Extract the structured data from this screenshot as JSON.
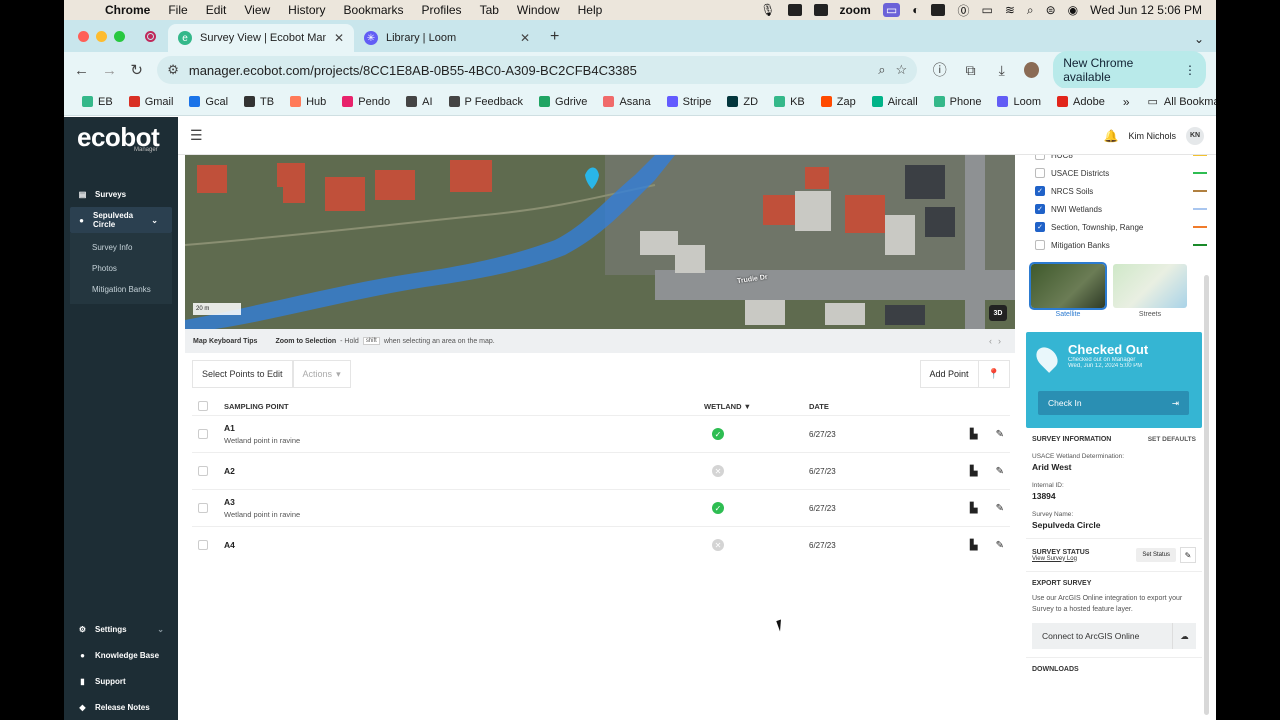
{
  "menubar": {
    "app": "Chrome",
    "items": [
      "File",
      "Edit",
      "View",
      "History",
      "Bookmarks",
      "Profiles",
      "Tab",
      "Window",
      "Help"
    ],
    "zoom": "zoom",
    "datetime": "Wed Jun 12  5:06 PM"
  },
  "tabs": [
    {
      "title": "Survey View | Ecobot Manage",
      "active": true,
      "color": "#34b88a"
    },
    {
      "title": "Library | Loom",
      "active": false,
      "color": "#625df5"
    }
  ],
  "toolbar": {
    "url": "manager.ecobot.com/projects/8CC1E8AB-0B55-4BC0-A309-BC2CFB4C3385",
    "new_chrome": "New Chrome available"
  },
  "bookmarks": [
    {
      "label": "EB",
      "color": "#34b88a"
    },
    {
      "label": "Gmail",
      "color": "#d93025"
    },
    {
      "label": "Gcal",
      "color": "#1a73e8"
    },
    {
      "label": "TB",
      "color": "#333333"
    },
    {
      "label": "Hub",
      "color": "#ff7a59"
    },
    {
      "label": "Pendo",
      "color": "#e8226b"
    },
    {
      "label": "AI",
      "color": "#444444"
    },
    {
      "label": "P Feedback",
      "color": "#444444"
    },
    {
      "label": "Gdrive",
      "color": "#1fa463"
    },
    {
      "label": "Asana",
      "color": "#f06a6a"
    },
    {
      "label": "Stripe",
      "color": "#635bff"
    },
    {
      "label": "ZD",
      "color": "#03363d"
    },
    {
      "label": "KB",
      "color": "#34b88a"
    },
    {
      "label": "Zap",
      "color": "#ff4a00"
    },
    {
      "label": "Aircall",
      "color": "#00b388"
    },
    {
      "label": "Phone",
      "color": "#34b88a"
    },
    {
      "label": "Loom",
      "color": "#625df5"
    },
    {
      "label": "Adobe",
      "color": "#e1251b"
    }
  ],
  "bookmarks_more": "»",
  "bookmarks_all": "All Bookmarks",
  "sidebar": {
    "logo": "ecobot",
    "logo_sub": "Manager",
    "surveys": "Surveys",
    "project": "Sepulveda Circle",
    "subitems": [
      "Survey Info",
      "Photos",
      "Mitigation Banks"
    ],
    "bottom": [
      "Settings",
      "Knowledge Base",
      "Support",
      "Release Notes"
    ]
  },
  "user": {
    "name": "Kim Nichols",
    "initials": "KN"
  },
  "map": {
    "scale": "20 m",
    "road": "Trudie Dr",
    "btn3d": "3D"
  },
  "tips": {
    "title": "Map Keyboard Tips",
    "zoom": "Zoom to Selection",
    "hold": "- Hold",
    "key": "shift",
    "rest": "when selecting an area on the map."
  },
  "actions": {
    "select": "Select Points to Edit",
    "actions": "Actions",
    "add": "Add Point"
  },
  "table": {
    "headers": {
      "point": "SAMPLING POINT",
      "wetland": "WETLAND",
      "date": "DATE"
    },
    "rows": [
      {
        "name": "A1",
        "desc": "Wetland point in ravine",
        "wetland": true,
        "date": "6/27/23"
      },
      {
        "name": "A2",
        "desc": "",
        "wetland": false,
        "date": "6/27/23"
      },
      {
        "name": "A3",
        "desc": "Wetland point in ravine",
        "wetland": true,
        "date": "6/27/23"
      },
      {
        "name": "A4",
        "desc": "",
        "wetland": false,
        "date": "6/27/23"
      }
    ]
  },
  "layers": [
    {
      "label": "HUC8",
      "checked": false,
      "color": "#f2c230"
    },
    {
      "label": "USACE Districts",
      "checked": false,
      "color": "#2ebd52"
    },
    {
      "label": "NRCS Soils",
      "checked": true,
      "color": "#b08040"
    },
    {
      "label": "NWI Wetlands",
      "checked": true,
      "color": "#a9c6ef"
    },
    {
      "label": "Section, Township, Range",
      "checked": true,
      "color": "#f07b2b"
    },
    {
      "label": "Mitigation Banks",
      "checked": false,
      "color": "#1a8a2a"
    }
  ],
  "basemaps": [
    "Satellite",
    "Streets"
  ],
  "checked_out": {
    "title": "Checked Out",
    "line1": "Checked out on Manager",
    "line2": "Wed, Jun 12, 2024 5:00 PM",
    "button": "Check In"
  },
  "survey_info": {
    "title": "SURVEY INFORMATION",
    "defaults": "SET DEFAULTS",
    "det_label": "USACE Wetland Determination:",
    "det_value": "Arid West",
    "id_label": "Internal ID:",
    "id_value": "13894",
    "name_label": "Survey Name:",
    "name_value": "Sepulveda Circle"
  },
  "survey_status": {
    "title": "SURVEY STATUS",
    "log": "View Survey Log",
    "set": "Set Status"
  },
  "export": {
    "title": "EXPORT SURVEY",
    "text": "Use our ArcGIS Online integration to export your Survey to a hosted feature layer.",
    "button": "Connect to ArcGIS Online"
  },
  "downloads": {
    "title": "DOWNLOADS"
  }
}
